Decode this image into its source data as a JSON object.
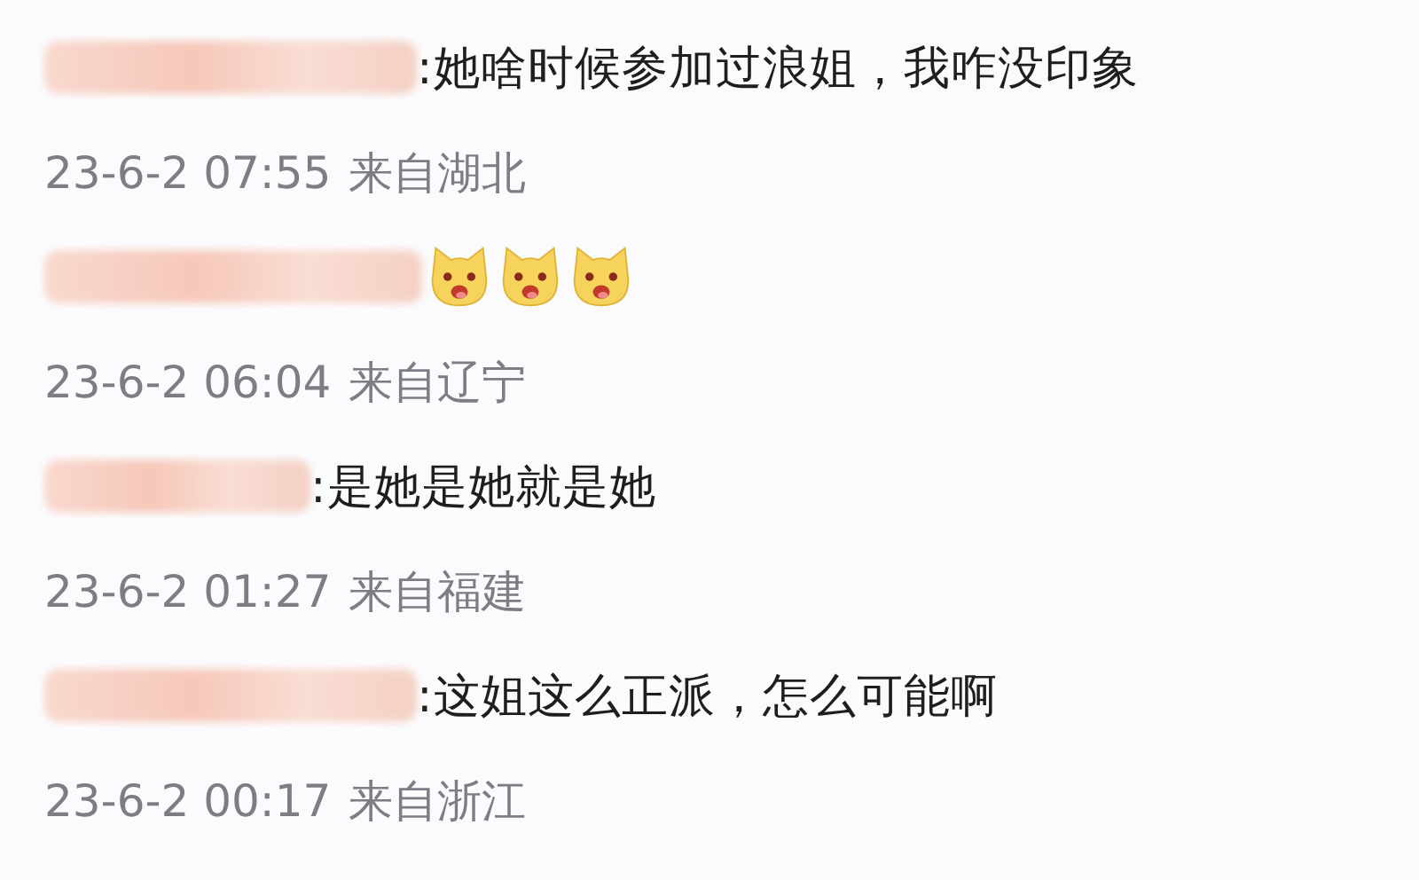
{
  "comments": [
    {
      "text": ":她啥时候参加过浪姐，我咋没印象",
      "time": "23-6-2 07:55",
      "location": "来自湖北"
    },
    {
      "emojis": [
        {
          "kind": "dog-face"
        },
        {
          "kind": "dog-face"
        },
        {
          "kind": "dog-face"
        }
      ],
      "time": "23-6-2 06:04",
      "location": "来自辽宁"
    },
    {
      "text": ":是她是她就是她",
      "time": "23-6-2 01:27",
      "location": "来自福建"
    },
    {
      "text": ":这姐这么正派，怎么可能啊",
      "time": "23-6-2 00:17",
      "location": "来自浙江"
    }
  ]
}
